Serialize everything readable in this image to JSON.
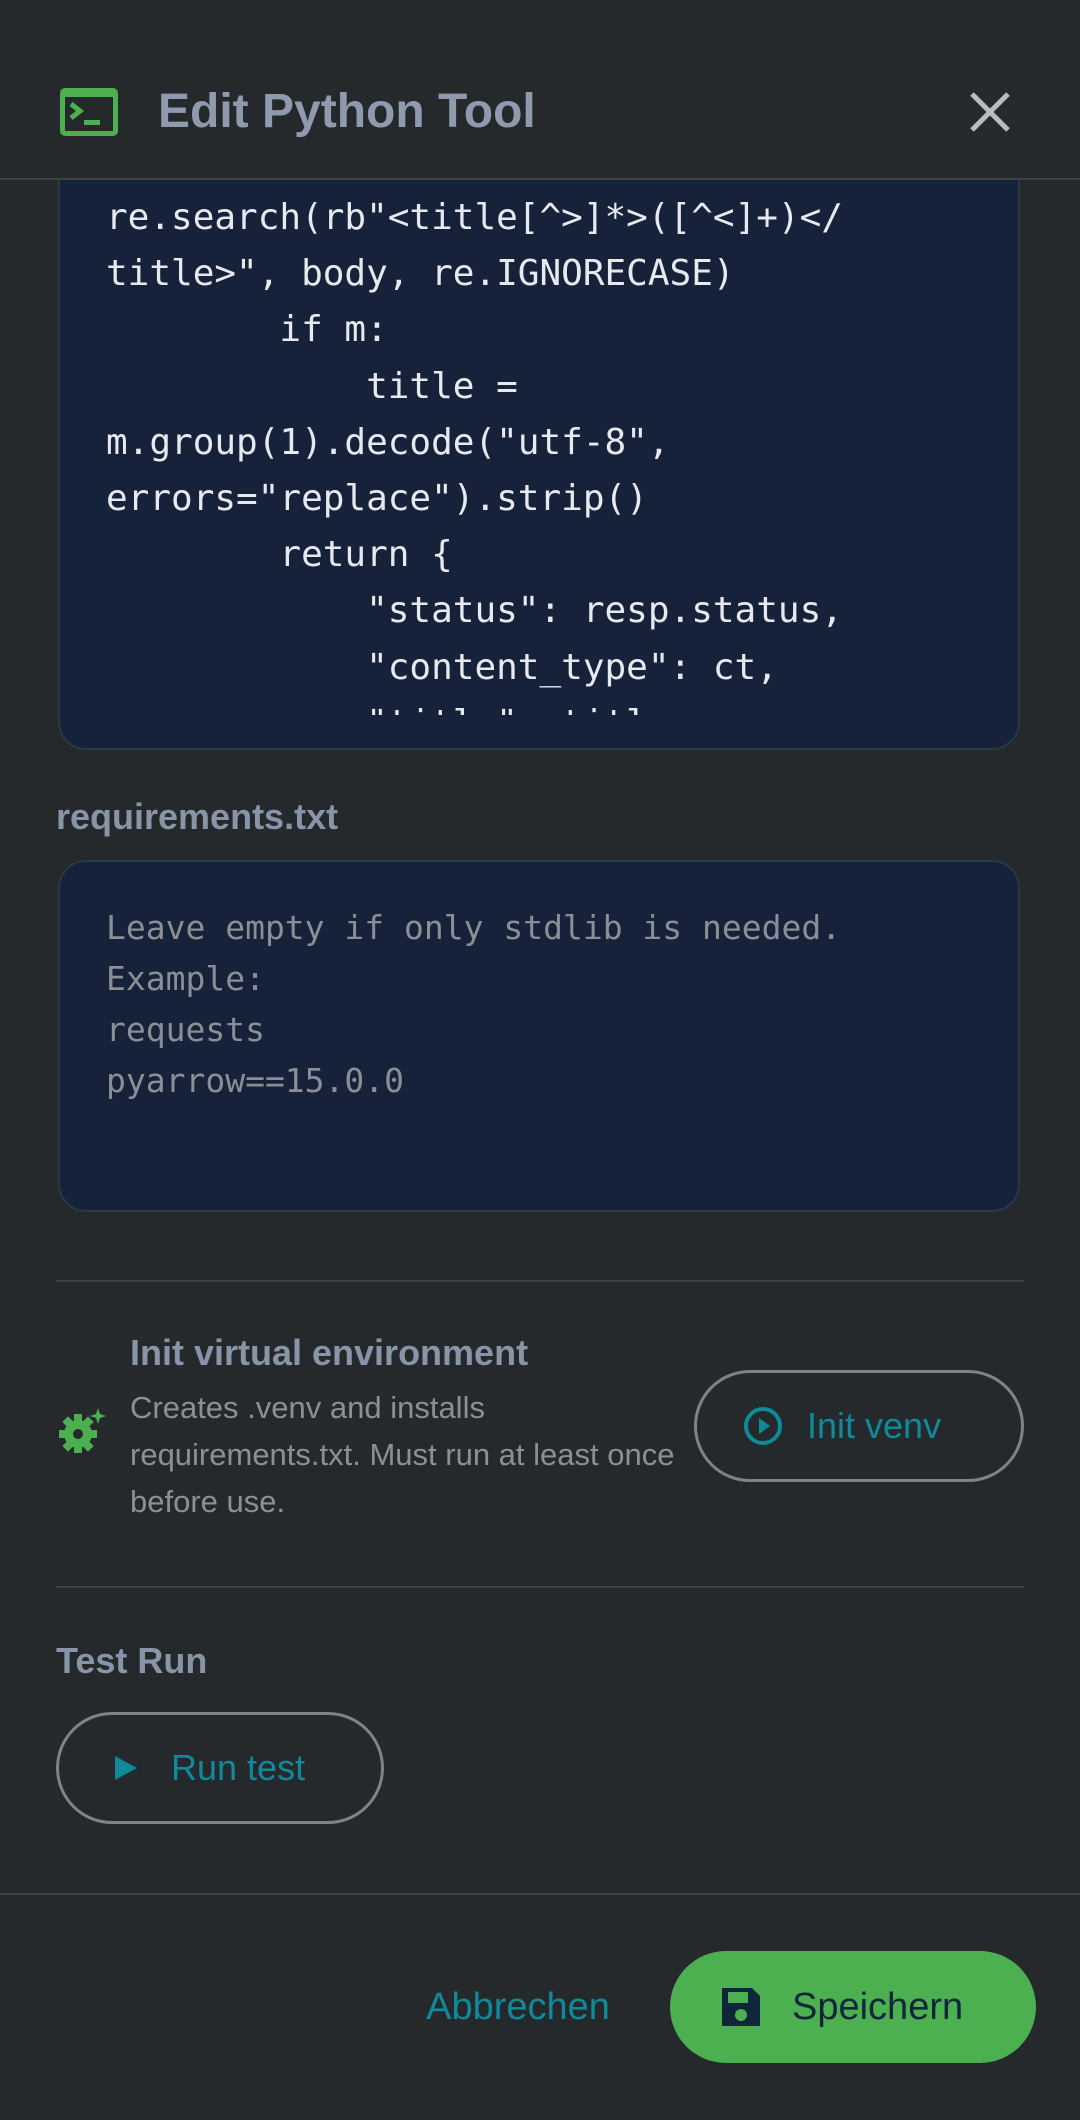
{
  "header": {
    "title": "Edit Python Tool",
    "terminal_icon": "terminal-icon",
    "close_icon": "close-icon"
  },
  "code_editor": {
    "lines": "re.search(rb\"<title[^>]*>([^<]+)</\ntitle>\", body, re.IGNORECASE)\n        if m:\n            title =\nm.group(1).decode(\"utf-8\",\nerrors=\"replace\").strip()\n        return {\n            \"status\": resp.status,\n            \"content_type\": ct,\n            \"title\": title"
  },
  "requirements": {
    "label": "requirements.txt",
    "value": "",
    "placeholder": "Leave empty if only stdlib is needed.\nExample:\nrequests\npyarrow==15.0.0"
  },
  "venv": {
    "title": "Init virtual environment",
    "description": "Creates .venv and installs requirements.txt. Must run at least once before use.",
    "button_label": "Init venv",
    "icon": "gear-icon"
  },
  "test_run": {
    "label": "Test Run",
    "button_label": "Run test"
  },
  "footer": {
    "cancel_label": "Abbrechen",
    "save_label": "Speichern"
  },
  "colors": {
    "accent_green": "#4caf50",
    "accent_teal": "#0f8a9a",
    "background": "#25292c",
    "editor_background": "#16213a"
  }
}
